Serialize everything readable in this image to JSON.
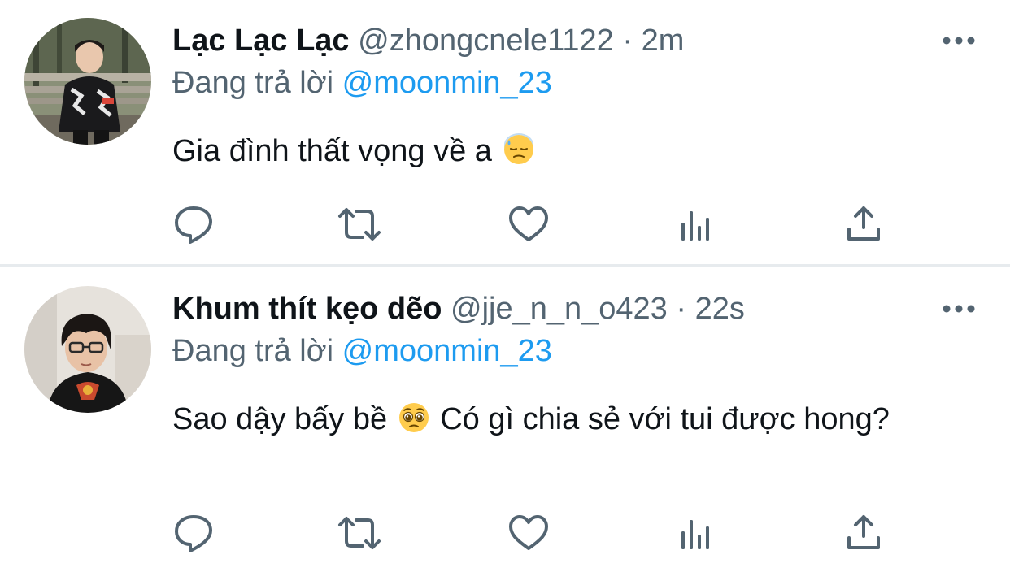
{
  "colors": {
    "text": "#0f1419",
    "secondary": "#536471",
    "accent": "#1d9bf0",
    "divider": "#e7ebee"
  },
  "tweets": [
    {
      "display_name": "Lạc Lạc Lạc",
      "handle": "@zhongcnele1122",
      "separator": "·",
      "time": "2m",
      "replying_label": "Đang trả lời",
      "replying_to": "@moonmin_23",
      "text_before_emoji": "Gia đình thất vọng về a",
      "emoji_icon": "downcast-face-with-sweat-icon",
      "text_after_emoji": ""
    },
    {
      "display_name": "Khum thít kẹo dẽo",
      "handle": "@jje_n_n_o423",
      "separator": "·",
      "time": "22s",
      "replying_label": "Đang trả lời",
      "replying_to": "@moonmin_23",
      "text_before_emoji": "Sao dậy bấy bề",
      "emoji_icon": "pleading-face-icon",
      "text_after_emoji": "Có gì chia sẻ với tui được hong?"
    }
  ],
  "action_icons": [
    "reply-icon",
    "retweet-icon",
    "like-icon",
    "analytics-icon",
    "share-icon"
  ],
  "more_icon": "more-horizontal-icon"
}
